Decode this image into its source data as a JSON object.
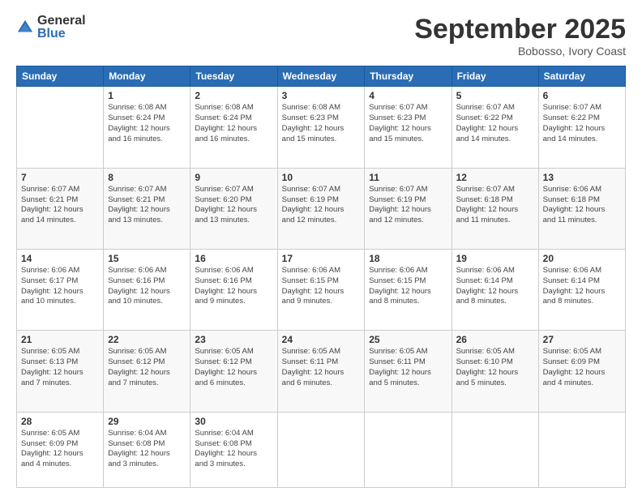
{
  "logo": {
    "general": "General",
    "blue": "Blue"
  },
  "title": "September 2025",
  "location": "Bobosso, Ivory Coast",
  "days_of_week": [
    "Sunday",
    "Monday",
    "Tuesday",
    "Wednesday",
    "Thursday",
    "Friday",
    "Saturday"
  ],
  "weeks": [
    [
      {
        "day": "",
        "info": ""
      },
      {
        "day": "1",
        "info": "Sunrise: 6:08 AM\nSunset: 6:24 PM\nDaylight: 12 hours\nand 16 minutes."
      },
      {
        "day": "2",
        "info": "Sunrise: 6:08 AM\nSunset: 6:24 PM\nDaylight: 12 hours\nand 16 minutes."
      },
      {
        "day": "3",
        "info": "Sunrise: 6:08 AM\nSunset: 6:23 PM\nDaylight: 12 hours\nand 15 minutes."
      },
      {
        "day": "4",
        "info": "Sunrise: 6:07 AM\nSunset: 6:23 PM\nDaylight: 12 hours\nand 15 minutes."
      },
      {
        "day": "5",
        "info": "Sunrise: 6:07 AM\nSunset: 6:22 PM\nDaylight: 12 hours\nand 14 minutes."
      },
      {
        "day": "6",
        "info": "Sunrise: 6:07 AM\nSunset: 6:22 PM\nDaylight: 12 hours\nand 14 minutes."
      }
    ],
    [
      {
        "day": "7",
        "info": "Sunrise: 6:07 AM\nSunset: 6:21 PM\nDaylight: 12 hours\nand 14 minutes."
      },
      {
        "day": "8",
        "info": "Sunrise: 6:07 AM\nSunset: 6:21 PM\nDaylight: 12 hours\nand 13 minutes."
      },
      {
        "day": "9",
        "info": "Sunrise: 6:07 AM\nSunset: 6:20 PM\nDaylight: 12 hours\nand 13 minutes."
      },
      {
        "day": "10",
        "info": "Sunrise: 6:07 AM\nSunset: 6:19 PM\nDaylight: 12 hours\nand 12 minutes."
      },
      {
        "day": "11",
        "info": "Sunrise: 6:07 AM\nSunset: 6:19 PM\nDaylight: 12 hours\nand 12 minutes."
      },
      {
        "day": "12",
        "info": "Sunrise: 6:07 AM\nSunset: 6:18 PM\nDaylight: 12 hours\nand 11 minutes."
      },
      {
        "day": "13",
        "info": "Sunrise: 6:06 AM\nSunset: 6:18 PM\nDaylight: 12 hours\nand 11 minutes."
      }
    ],
    [
      {
        "day": "14",
        "info": "Sunrise: 6:06 AM\nSunset: 6:17 PM\nDaylight: 12 hours\nand 10 minutes."
      },
      {
        "day": "15",
        "info": "Sunrise: 6:06 AM\nSunset: 6:16 PM\nDaylight: 12 hours\nand 10 minutes."
      },
      {
        "day": "16",
        "info": "Sunrise: 6:06 AM\nSunset: 6:16 PM\nDaylight: 12 hours\nand 9 minutes."
      },
      {
        "day": "17",
        "info": "Sunrise: 6:06 AM\nSunset: 6:15 PM\nDaylight: 12 hours\nand 9 minutes."
      },
      {
        "day": "18",
        "info": "Sunrise: 6:06 AM\nSunset: 6:15 PM\nDaylight: 12 hours\nand 8 minutes."
      },
      {
        "day": "19",
        "info": "Sunrise: 6:06 AM\nSunset: 6:14 PM\nDaylight: 12 hours\nand 8 minutes."
      },
      {
        "day": "20",
        "info": "Sunrise: 6:06 AM\nSunset: 6:14 PM\nDaylight: 12 hours\nand 8 minutes."
      }
    ],
    [
      {
        "day": "21",
        "info": "Sunrise: 6:05 AM\nSunset: 6:13 PM\nDaylight: 12 hours\nand 7 minutes."
      },
      {
        "day": "22",
        "info": "Sunrise: 6:05 AM\nSunset: 6:12 PM\nDaylight: 12 hours\nand 7 minutes."
      },
      {
        "day": "23",
        "info": "Sunrise: 6:05 AM\nSunset: 6:12 PM\nDaylight: 12 hours\nand 6 minutes."
      },
      {
        "day": "24",
        "info": "Sunrise: 6:05 AM\nSunset: 6:11 PM\nDaylight: 12 hours\nand 6 minutes."
      },
      {
        "day": "25",
        "info": "Sunrise: 6:05 AM\nSunset: 6:11 PM\nDaylight: 12 hours\nand 5 minutes."
      },
      {
        "day": "26",
        "info": "Sunrise: 6:05 AM\nSunset: 6:10 PM\nDaylight: 12 hours\nand 5 minutes."
      },
      {
        "day": "27",
        "info": "Sunrise: 6:05 AM\nSunset: 6:09 PM\nDaylight: 12 hours\nand 4 minutes."
      }
    ],
    [
      {
        "day": "28",
        "info": "Sunrise: 6:05 AM\nSunset: 6:09 PM\nDaylight: 12 hours\nand 4 minutes."
      },
      {
        "day": "29",
        "info": "Sunrise: 6:04 AM\nSunset: 6:08 PM\nDaylight: 12 hours\nand 3 minutes."
      },
      {
        "day": "30",
        "info": "Sunrise: 6:04 AM\nSunset: 6:08 PM\nDaylight: 12 hours\nand 3 minutes."
      },
      {
        "day": "",
        "info": ""
      },
      {
        "day": "",
        "info": ""
      },
      {
        "day": "",
        "info": ""
      },
      {
        "day": "",
        "info": ""
      }
    ]
  ]
}
